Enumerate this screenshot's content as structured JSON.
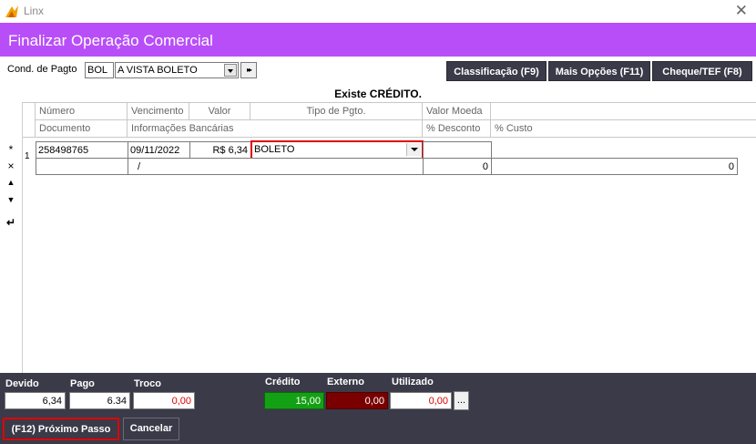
{
  "window": {
    "title": "Linx",
    "close_glyph": "✕"
  },
  "header": {
    "title": "Finalizar Operação Comercial"
  },
  "payment": {
    "cond_label": "Cond. de Pagto",
    "cond_code": "BOL",
    "cond_value": "A VISTA BOLETO",
    "ff_glyph": "▸▸"
  },
  "top_buttons": {
    "classificacao": "Classificação (F9)",
    "mais_opcoes": "Mais Opções (F11)",
    "cheque_tef": "Cheque/TEF (F8)"
  },
  "credit_message": "Existe CRÉDITO.",
  "grid": {
    "headers_row1": [
      "Número",
      "Vencimento",
      "Valor",
      "Tipo de Pgto.",
      "Valor Moeda"
    ],
    "headers_row2": [
      "Documento",
      "Informações Bancárias",
      "% Desconto",
      "% Custo"
    ],
    "row": {
      "index": "1",
      "numero": "258498765",
      "vencimento": "09/11/2022",
      "valor": "R$ 6,34",
      "tipo_pgto": "BOLETO",
      "info_bancarias": "/",
      "desconto": "0",
      "custo": "0"
    },
    "side_icons": [
      "*",
      "×",
      "▲",
      "▼",
      "↵"
    ]
  },
  "footer": {
    "devido_label": "Devido",
    "devido": "6,34",
    "pago_label": "Pago",
    "pago": "6.34",
    "troco_label": "Troco",
    "troco": "0,00",
    "credito_label": "Crédito",
    "credito": "15,00",
    "externo_label": "Externo",
    "externo": "0,00",
    "utilizado_label": "Utilizado",
    "utilizado": "0,00",
    "dots": "...",
    "next_label": "(F12) Próximo Passo",
    "cancel_label": "Cancelar"
  },
  "colors": {
    "header_bg": "#b84ef7",
    "dark_bg": "#3b3a49",
    "highlight_red": "#e00000",
    "credito_green": "#14a014",
    "externo_darkred": "#7a0000"
  }
}
